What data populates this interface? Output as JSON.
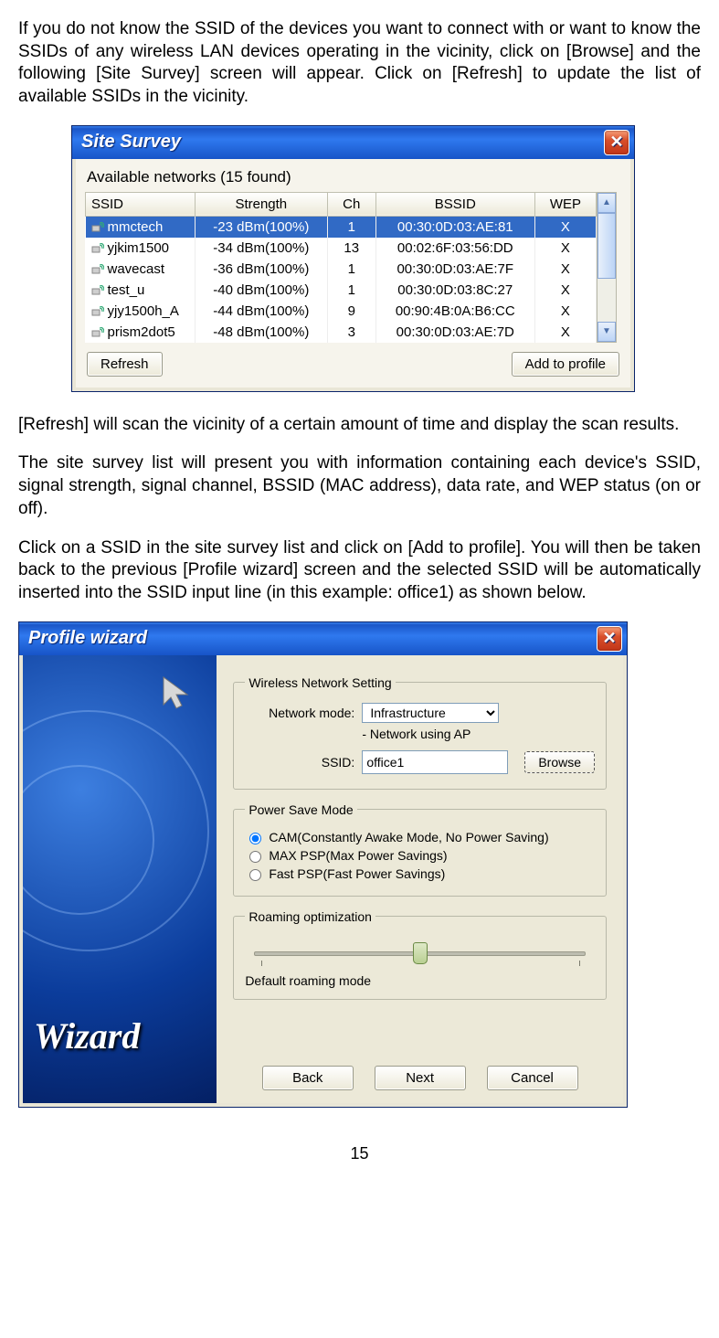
{
  "para1": "If you do not know the SSID of the devices you want to connect with or want to know the SSIDs of any wireless LAN devices operating in the vicinity, click on [Browse] and the following [Site Survey] screen will appear. Click on [Refresh] to update the list of available SSIDs in the vicinity.",
  "para2": "[Refresh] will scan the vicinity of a certain amount of time and display the scan results.",
  "para3": "The site survey list will present you with information containing each device's SSID, signal strength, signal channel, BSSID (MAC address), data rate, and WEP status (on or off).",
  "para4": "Click on a SSID in the site survey list and click on [Add to profile]. You will then be taken back to the previous [Profile wizard] screen and the selected SSID will be automatically inserted into the SSID input line (in this example: office1) as shown below.",
  "page_number": "15",
  "site_survey": {
    "title": "Site Survey",
    "available_label": "Available networks  (15 found)",
    "headers": {
      "ssid": "SSID",
      "strength": "Strength",
      "ch": "Ch",
      "bssid": "BSSID",
      "wep": "WEP"
    },
    "rows": [
      {
        "ssid": "mmctech",
        "strength": "-23 dBm(100%)",
        "ch": "1",
        "bssid": "00:30:0D:03:AE:81",
        "wep": "X",
        "selected": true
      },
      {
        "ssid": "yjkim1500",
        "strength": "-34 dBm(100%)",
        "ch": "13",
        "bssid": "00:02:6F:03:56:DD",
        "wep": "X"
      },
      {
        "ssid": "wavecast",
        "strength": "-36 dBm(100%)",
        "ch": "1",
        "bssid": "00:30:0D:03:AE:7F",
        "wep": "X"
      },
      {
        "ssid": "test_u",
        "strength": "-40 dBm(100%)",
        "ch": "1",
        "bssid": "00:30:0D:03:8C:27",
        "wep": "X"
      },
      {
        "ssid": "yjy1500h_A",
        "strength": "-44 dBm(100%)",
        "ch": "9",
        "bssid": "00:90:4B:0A:B6:CC",
        "wep": "X"
      },
      {
        "ssid": "prism2dot5",
        "strength": "-48 dBm(100%)",
        "ch": "3",
        "bssid": "00:30:0D:03:AE:7D",
        "wep": "X"
      }
    ],
    "refresh_btn": "Refresh",
    "add_btn": "Add to profile"
  },
  "profile_wizard": {
    "title": "Profile wizard",
    "wizard_word": "Wizard",
    "group_net": "Wireless Network Setting",
    "netmode_label": "Network mode:",
    "netmode_value": "Infrastructure",
    "netmode_sub": "- Network using AP",
    "ssid_label": "SSID:",
    "ssid_value": "office1",
    "browse_btn": "Browse",
    "group_power": "Power Save Mode",
    "power_opts": [
      "CAM(Constantly Awake Mode, No Power Saving)",
      "MAX PSP(Max Power Savings)",
      "Fast PSP(Fast Power Savings)"
    ],
    "group_roam": "Roaming optimization",
    "roam_label": "Default roaming mode",
    "back_btn": "Back",
    "next_btn": "Next",
    "cancel_btn": "Cancel"
  }
}
